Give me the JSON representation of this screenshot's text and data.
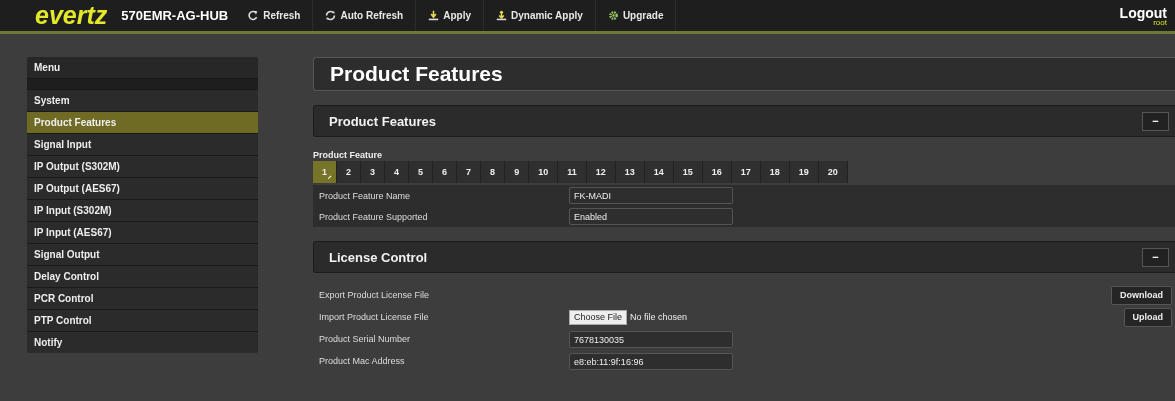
{
  "header": {
    "logo": "evertz",
    "device": "570EMR-AG-HUB",
    "toolbar": [
      {
        "label": "Refresh",
        "kind": "refresh"
      },
      {
        "label": "Auto Refresh",
        "kind": "autorefresh"
      },
      {
        "label": "Apply",
        "kind": "apply"
      },
      {
        "label": "Dynamic Apply",
        "kind": "dynamic"
      },
      {
        "label": "Upgrade",
        "kind": "upgrade"
      }
    ],
    "logout": "Logout",
    "user": "root"
  },
  "sidebar": {
    "title": "Menu",
    "items": [
      {
        "label": "System",
        "selected": false
      },
      {
        "label": "Product Features",
        "selected": true
      },
      {
        "label": "Signal Input",
        "selected": false
      },
      {
        "label": "IP Output (S302M)",
        "selected": false
      },
      {
        "label": "IP Output (AES67)",
        "selected": false
      },
      {
        "label": "IP Input (S302M)",
        "selected": false
      },
      {
        "label": "IP Input (AES67)",
        "selected": false
      },
      {
        "label": "Signal Output",
        "selected": false
      },
      {
        "label": "Delay Control",
        "selected": false
      },
      {
        "label": "PCR Control",
        "selected": false
      },
      {
        "label": "PTP Control",
        "selected": false
      },
      {
        "label": "Notify",
        "selected": false
      }
    ]
  },
  "page_title": "Product Features",
  "sections": [
    {
      "title": "Product Features",
      "collapse": "−",
      "kind": "features",
      "tabs_label": "Product Feature",
      "tabs": [
        {
          "label": "1",
          "selected": true
        },
        {
          "label": "2",
          "selected": false
        },
        {
          "label": "3",
          "selected": false
        },
        {
          "label": "4",
          "selected": false
        },
        {
          "label": "5",
          "selected": false
        },
        {
          "label": "6",
          "selected": false
        },
        {
          "label": "7",
          "selected": false
        },
        {
          "label": "8",
          "selected": false
        },
        {
          "label": "9",
          "selected": false
        },
        {
          "label": "10",
          "selected": false
        },
        {
          "label": "11",
          "selected": false
        },
        {
          "label": "12",
          "selected": false
        },
        {
          "label": "13",
          "selected": false
        },
        {
          "label": "14",
          "selected": false
        },
        {
          "label": "15",
          "selected": false
        },
        {
          "label": "16",
          "selected": false
        },
        {
          "label": "17",
          "selected": false
        },
        {
          "label": "18",
          "selected": false
        },
        {
          "label": "19",
          "selected": false
        },
        {
          "label": "20",
          "selected": false
        }
      ],
      "rows": [
        {
          "kind": "field",
          "label": "Product Feature Name",
          "value": "FK-MADI"
        },
        {
          "kind": "field",
          "label": "Product Feature Supported",
          "value": "Enabled"
        }
      ]
    },
    {
      "title": "License Control",
      "collapse": "−",
      "kind": "license",
      "rows": [
        {
          "kind": "button",
          "label": "Export Product License File",
          "button": "Download"
        },
        {
          "kind": "file",
          "label": "Import Product License File",
          "choose": "Choose File",
          "status": "No file chosen",
          "button": "Upload"
        },
        {
          "kind": "field",
          "label": "Product Serial Number",
          "value": "7678130035"
        },
        {
          "kind": "field",
          "label": "Product Mac Address",
          "value": "e8:eb:11:9f:16:96"
        }
      ]
    }
  ]
}
